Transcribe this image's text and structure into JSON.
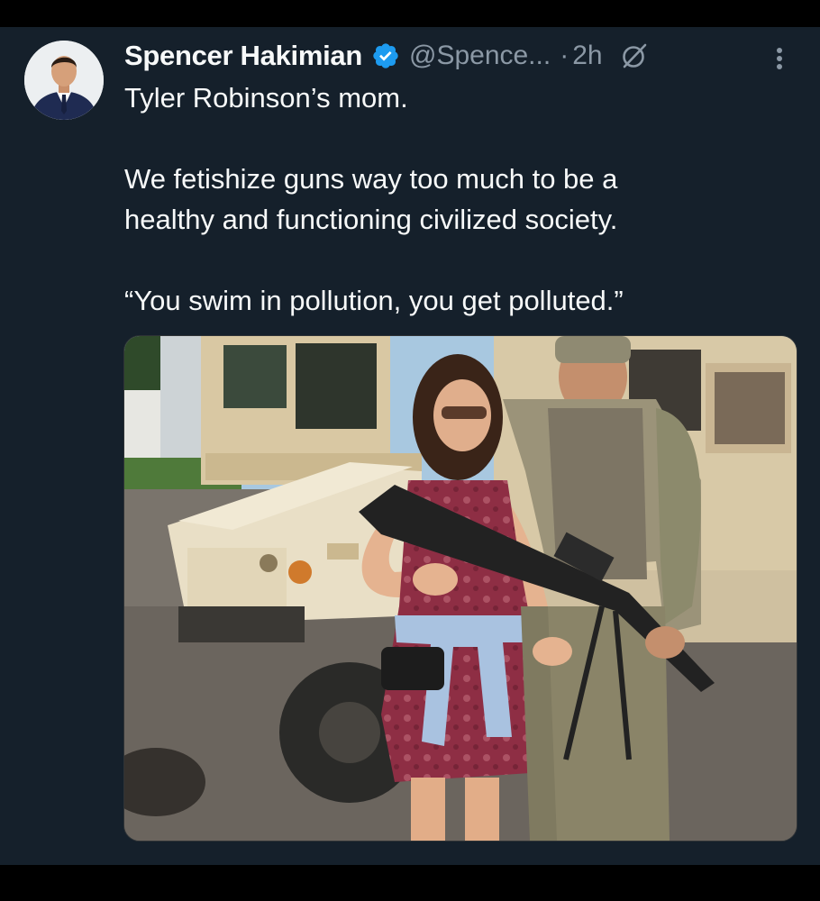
{
  "tweet": {
    "author_name": "Spencer Hakimian",
    "handle": "@Spence...",
    "separator": "·",
    "time": "2h",
    "text_lines": [
      "Tyler Robinson’s mom.",
      "",
      "We fetishize guns way too much to be a",
      "healthy and functioning civilized society.",
      "",
      "“You swim in pollution, you get polluted.”"
    ]
  },
  "icons": {
    "verified": "verified-badge-icon",
    "grok": "grok-icon",
    "more": "more-vertical-icon"
  },
  "colors": {
    "background": "#15202b",
    "text_primary": "#f7f9f9",
    "text_secondary": "#8b98a5",
    "verified_blue": "#1d9bf0"
  }
}
